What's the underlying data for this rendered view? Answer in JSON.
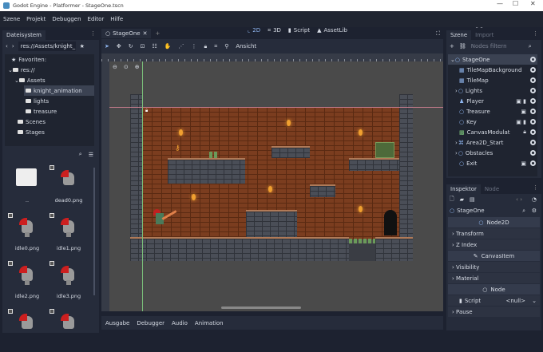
{
  "window": {
    "title": "Godot Engine - Platformer - StageOne.tscn",
    "minimize": "—",
    "maximize": "☐",
    "close": "✕"
  },
  "menu": [
    "Szene",
    "Projekt",
    "Debuggen",
    "Editor",
    "Hilfe"
  ],
  "workspaces": [
    {
      "label": "2D",
      "icon": "2d-icon"
    },
    {
      "label": "3D",
      "icon": "3d-icon"
    },
    {
      "label": "Script",
      "icon": "script-icon"
    },
    {
      "label": "AssetLib",
      "icon": "assetlib-icon"
    }
  ],
  "filesystem": {
    "tab": "Dateisystem",
    "path": "res://Assets/knight_",
    "tree": [
      {
        "label": "Favoriten:",
        "indent": 0
      },
      {
        "label": "res://",
        "indent": 0
      },
      {
        "label": "Assets",
        "indent": 1
      },
      {
        "label": "knight_animation",
        "indent": 2,
        "selected": true
      },
      {
        "label": "lights",
        "indent": 2
      },
      {
        "label": "treasure",
        "indent": 2
      },
      {
        "label": "Scenes",
        "indent": 1
      },
      {
        "label": "Stages",
        "indent": 1
      }
    ],
    "files": [
      "..",
      "dead0.png",
      "idle0.png",
      "idle1.png",
      "idle2.png",
      "idle3.png",
      "",
      ""
    ]
  },
  "editor": {
    "scene_tab": "StageOne",
    "view_menu": "Ansicht"
  },
  "bottom_tabs": [
    "Ausgabe",
    "Debugger",
    "Audio",
    "Animation"
  ],
  "scene_dock": {
    "tabs": [
      "Szene",
      "Import"
    ],
    "filter_placeholder": "Nodes filtern",
    "nodes": [
      {
        "label": "StageOne",
        "indent": 0
      },
      {
        "label": "TileMapBackground",
        "indent": 1
      },
      {
        "label": "TileMap",
        "indent": 1
      },
      {
        "label": "Lights",
        "indent": 1
      },
      {
        "label": "Player",
        "indent": 1
      },
      {
        "label": "Treasure",
        "indent": 1
      },
      {
        "label": "Key",
        "indent": 1
      },
      {
        "label": "CanvasModulat",
        "indent": 1
      },
      {
        "label": "Area2D_Start",
        "indent": 1
      },
      {
        "label": "Obstacles",
        "indent": 1
      },
      {
        "label": "Exit",
        "indent": 1
      }
    ]
  },
  "inspector": {
    "tabs": [
      "Inspektor",
      "Node"
    ],
    "object": "StageOne",
    "sections": [
      {
        "type": "header",
        "label": "Node2D"
      },
      {
        "type": "row",
        "label": "Transform"
      },
      {
        "type": "row",
        "label": "Z Index"
      },
      {
        "type": "header",
        "label": "CanvasItem"
      },
      {
        "type": "row",
        "label": "Visibility"
      },
      {
        "type": "row",
        "label": "Material"
      },
      {
        "type": "header",
        "label": "Node"
      }
    ],
    "script_label": "Script",
    "script_value": "<null>",
    "pause_label": "Pause"
  }
}
